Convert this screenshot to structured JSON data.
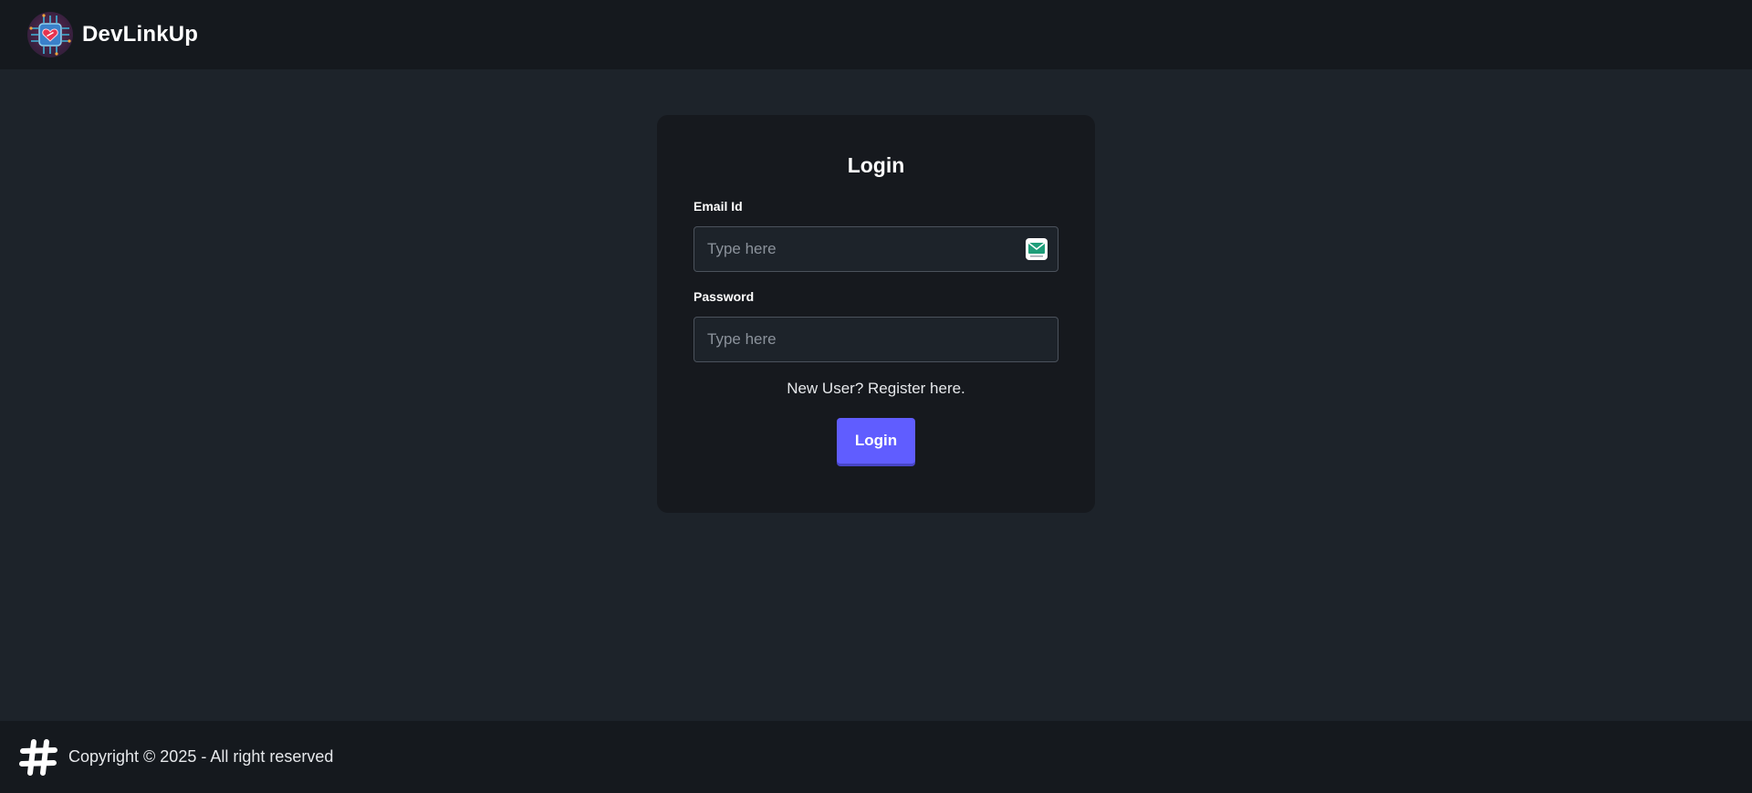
{
  "navbar": {
    "brand_name": "DevLinkUp",
    "logo_icon": "chip-heart-logo"
  },
  "login_card": {
    "title": "Login",
    "email": {
      "label": "Email Id",
      "placeholder": "Type here",
      "value": "",
      "extension_icon": "email-extension-icon"
    },
    "password": {
      "label": "Password",
      "placeholder": "Type here",
      "value": ""
    },
    "register_link": "New User? Register here.",
    "submit_label": "Login"
  },
  "footer": {
    "icon": "hash-icon",
    "copyright": "Copyright © 2025 - All right reserved"
  },
  "colors": {
    "page_bg": "#1d232a",
    "bar_bg": "#15191e",
    "card_bg": "#16191e",
    "primary": "#605dff",
    "text": "#e6e8eb"
  }
}
